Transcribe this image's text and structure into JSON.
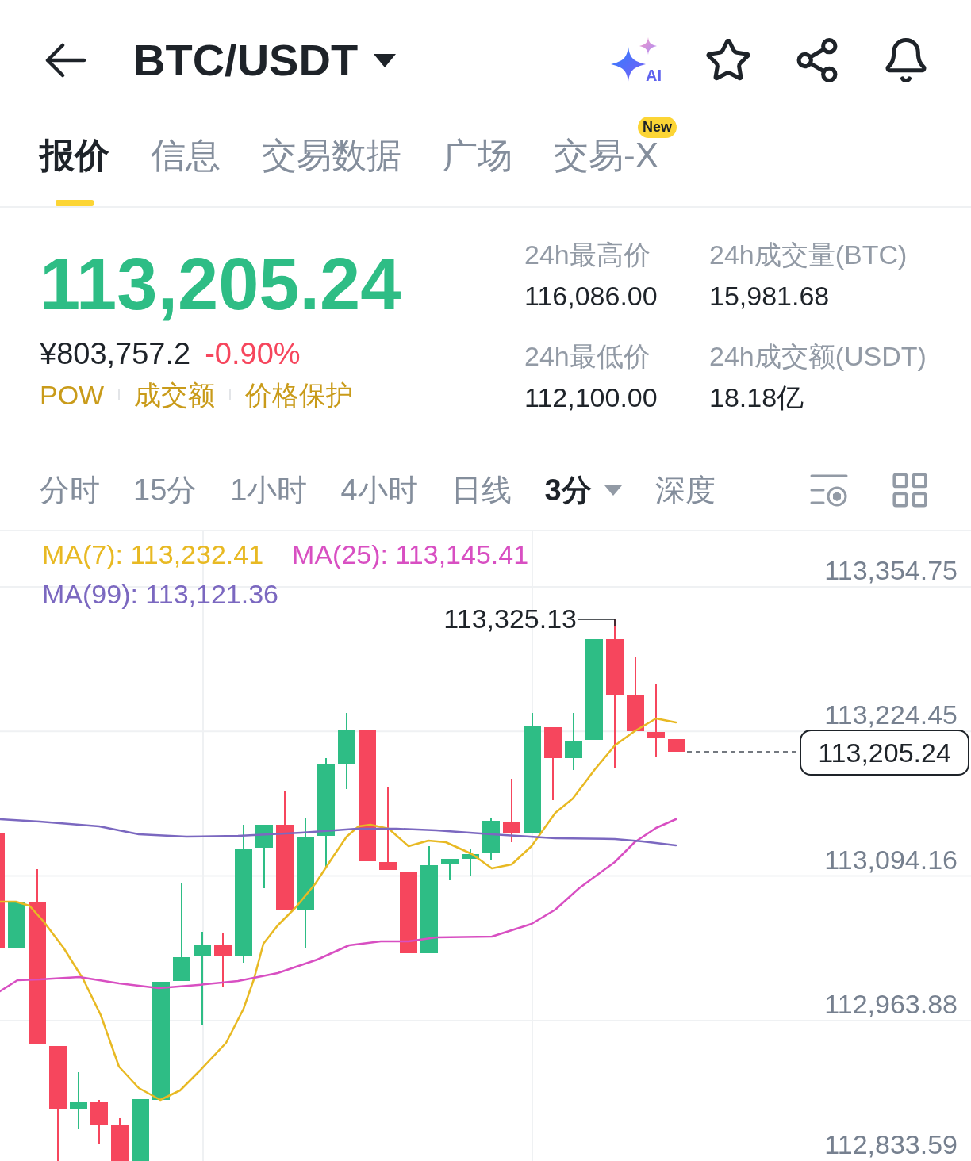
{
  "header": {
    "title": "BTC/USDT",
    "ai_label": "AI"
  },
  "tabs": [
    {
      "label": "报价",
      "selected": true
    },
    {
      "label": "信息",
      "selected": false
    },
    {
      "label": "交易数据",
      "selected": false
    },
    {
      "label": "广场",
      "selected": false
    },
    {
      "label": "交易-X",
      "selected": false,
      "badge": "New"
    }
  ],
  "ticker": {
    "last_price": "113,205.24",
    "cny_price": "¥803,757.2",
    "change": "-0.90%",
    "tags": [
      "POW",
      "成交额",
      "价格保护"
    ],
    "stats": [
      {
        "label": "24h最高价",
        "value": "116,086.00"
      },
      {
        "label": "24h成交量(BTC)",
        "value": "15,981.68"
      },
      {
        "label": "24h最低价",
        "value": "112,100.00"
      },
      {
        "label": "24h成交额(USDT)",
        "value": "18.18亿"
      }
    ]
  },
  "intervals": [
    {
      "label": "分时",
      "selected": false,
      "kind": "plain"
    },
    {
      "label": "15分",
      "selected": false,
      "kind": "plain"
    },
    {
      "label": "1小时",
      "selected": false,
      "kind": "plain"
    },
    {
      "label": "4小时",
      "selected": false,
      "kind": "plain"
    },
    {
      "label": "日线",
      "selected": false,
      "kind": "plain"
    },
    {
      "label": "3分",
      "selected": true,
      "kind": "dropdown"
    },
    {
      "label": "深度",
      "selected": false,
      "kind": "plain"
    }
  ],
  "chart": {
    "ma_legend": [
      {
        "label": "MA(7): 113,232.41",
        "color": "#e8b923"
      },
      {
        "label": "MA(25): 113,145.41",
        "color": "#d84fc2"
      },
      {
        "label": "MA(99): 113,121.36",
        "color": "#7b68c0"
      }
    ],
    "price_axis": [
      "113,354.75",
      "113,224.45",
      "113,094.16",
      "112,963.88",
      "112,833.59"
    ],
    "high_marker": "113,325.13",
    "last_price_tag": "113,205.24"
  }
}
